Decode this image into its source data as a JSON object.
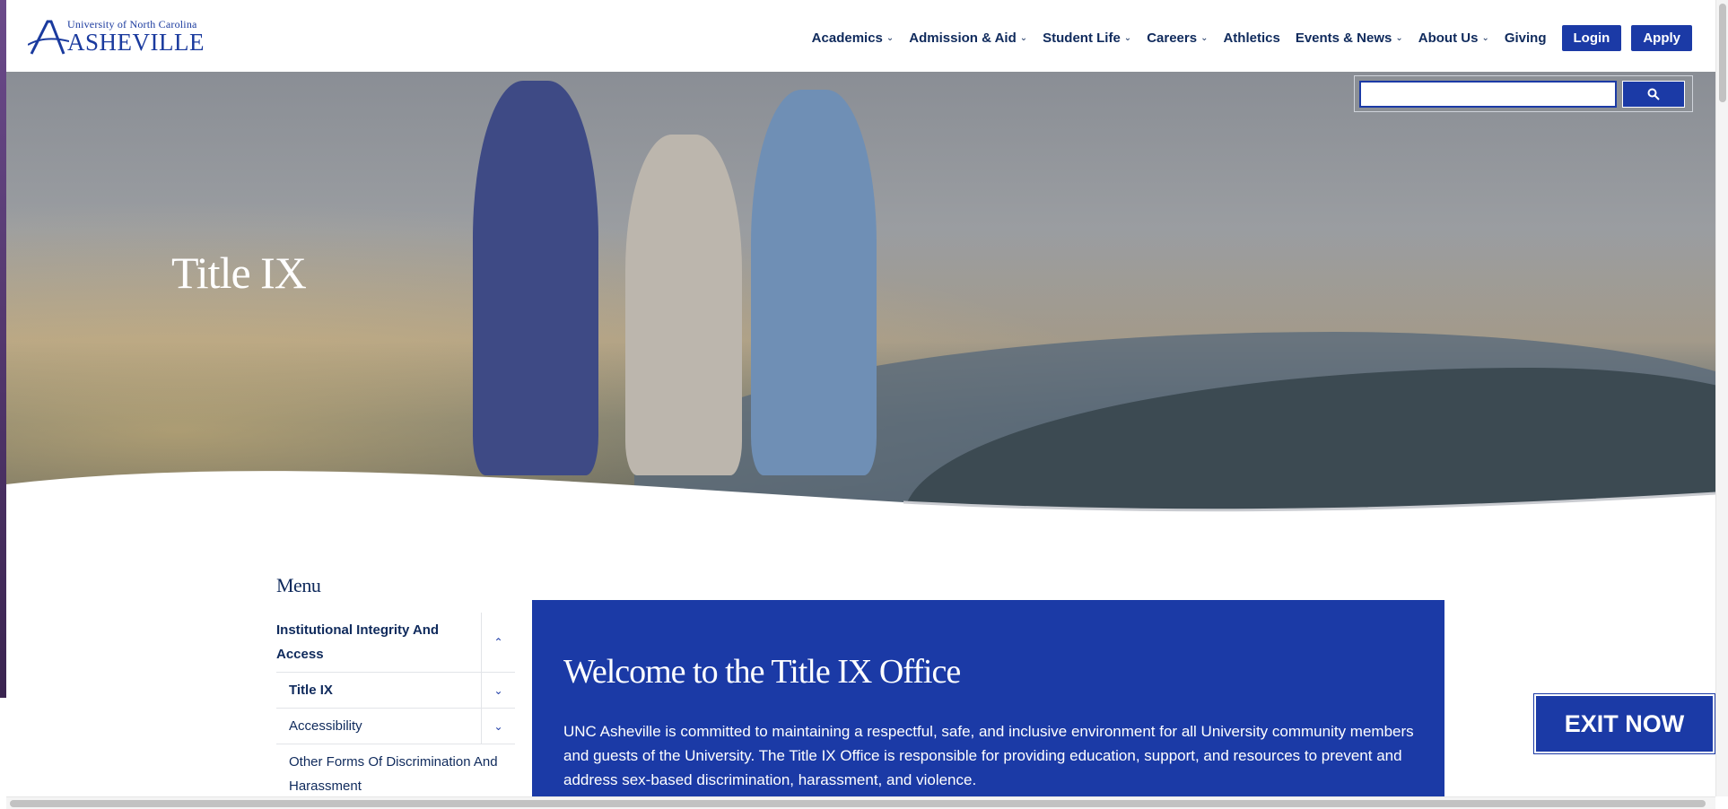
{
  "logo": {
    "top_line": "University of North Carolina",
    "main": "ASHEVILLE"
  },
  "nav": {
    "items": [
      {
        "label": "Academics",
        "has_dropdown": true
      },
      {
        "label": "Admission & Aid",
        "has_dropdown": true
      },
      {
        "label": "Student Life",
        "has_dropdown": true
      },
      {
        "label": "Careers",
        "has_dropdown": true
      },
      {
        "label": "Athletics",
        "has_dropdown": false
      },
      {
        "label": "Events & News",
        "has_dropdown": true
      },
      {
        "label": "About Us",
        "has_dropdown": true
      },
      {
        "label": "Giving",
        "has_dropdown": false
      }
    ],
    "login_label": "Login",
    "apply_label": "Apply"
  },
  "search": {
    "value": "",
    "icon": "search-icon"
  },
  "hero": {
    "title": "Title IX"
  },
  "menu": {
    "heading": "Menu",
    "items": [
      {
        "label": "Institutional Integrity And Access",
        "level": "top",
        "expanded": true
      },
      {
        "label": "Title IX",
        "level": "sub",
        "expanded": false
      },
      {
        "label": "Accessibility",
        "level": "sub",
        "expanded": false
      },
      {
        "label": "Other Forms Of Discrimination And Harassment",
        "level": "sub",
        "expanded": false
      }
    ]
  },
  "welcome": {
    "title": "Welcome to the Title IX Office",
    "text": "UNC Asheville is committed to maintaining a respectful, safe, and inclusive environment for all University community members and guests of the University. The Title IX Office is responsible for providing education, support, and resources to prevent and address sex-based discrimination, harassment, and violence."
  },
  "exit_button": {
    "label": "EXIT NOW"
  },
  "colors": {
    "brand_blue": "#1b3aa6",
    "nav_text": "#0f2a5c"
  }
}
